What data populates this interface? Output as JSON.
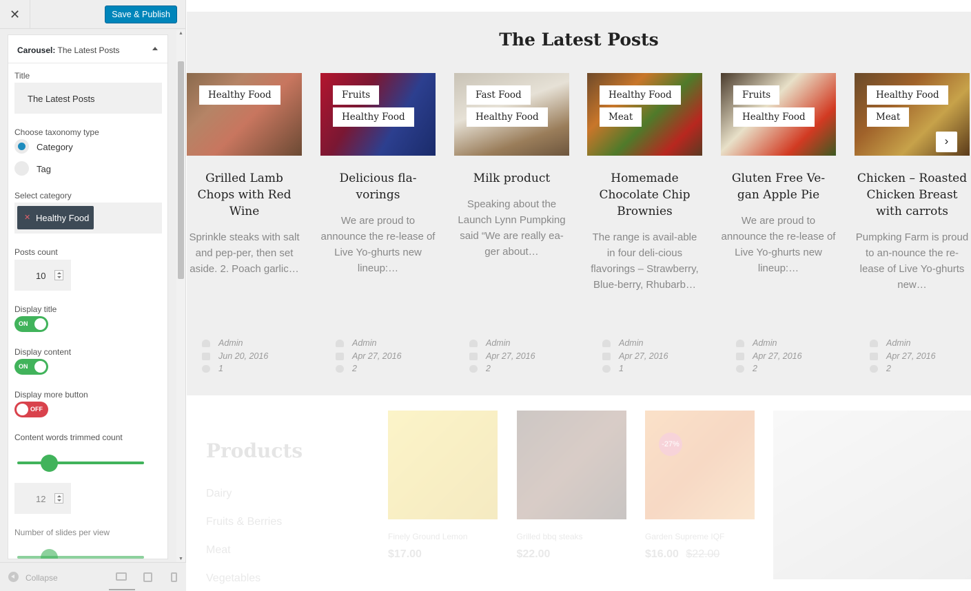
{
  "sidebar": {
    "close_label": "✕",
    "save_label": "Save & Publish",
    "section": {
      "prefix": "Carousel:",
      "name": "The Latest Posts"
    },
    "fields": {
      "title_label": "Title",
      "title_value": "The Latest Posts",
      "taxonomy_label": "Choose taxonomy type",
      "taxonomy_options": [
        "Category",
        "Tag"
      ],
      "taxonomy_selected": "Category",
      "category_label": "Select category",
      "category_chip": "Healthy Food",
      "posts_count_label": "Posts count",
      "posts_count_value": "10",
      "display_title_label": "Display title",
      "display_title_state": "ON",
      "display_content_label": "Display content",
      "display_content_state": "ON",
      "display_more_label": "Display more button",
      "display_more_state": "OFF",
      "trim_label": "Content words trimmed count",
      "trim_slider_fraction": 0.25,
      "trim_value": "12",
      "slides_label": "Number of slides per view",
      "slides_slider_fraction": 0.25
    },
    "footer": {
      "collapse_label": "Collapse",
      "devices": [
        "desktop-icon",
        "tablet-icon",
        "mobile-icon"
      ]
    }
  },
  "preview": {
    "heading": "The Latest Posts",
    "cards": [
      {
        "tags": [
          "Healthy Food"
        ],
        "title": "Grilled Lamb Chops with Red Wine",
        "excerpt": "Sprinkle steaks with salt and pep-per, then set aside. 2. Poach garlic…",
        "author": "Admin",
        "date": "Jun 20, 2016",
        "comments": "1",
        "img": "linear-gradient(135deg,#8a6a4d 0%,#b58466 30%,#c8765f 55%,#6b4a34 100%)"
      },
      {
        "tags": [
          "Fruits",
          "Healthy Food"
        ],
        "title": "Delicious fla-vorings",
        "excerpt": "We are proud to announce the re-lease of Live Yo-ghurts new lineup:…",
        "author": "Admin",
        "date": "Apr 27, 2016",
        "comments": "2",
        "img": "linear-gradient(120deg,#b3162e 0%,#7a1733 35%,#2c3f8f 65%,#1a2b6a 100%)"
      },
      {
        "tags": [
          "Fast Food",
          "Healthy Food"
        ],
        "title": "Milk product",
        "excerpt": "Speaking about the Launch Lynn Pumpking said “We are really ea-ger about…",
        "author": "Admin",
        "date": "Apr 27, 2016",
        "comments": "2",
        "img": "linear-gradient(160deg,#c9c3b6 0%,#e6e1d6 40%,#9a7d5a 75%,#6d563e 100%)"
      },
      {
        "tags": [
          "Healthy Food",
          "Meat"
        ],
        "title": "Homemade Chocolate Chip Brownies",
        "excerpt": "The range is avail-able in four deli-cious flavorings – Strawberry, Blue-berry, Rhubarb…",
        "author": "Admin",
        "date": "Apr 27, 2016",
        "comments": "1",
        "img": "linear-gradient(135deg,#6e4a2a 0%,#c8762a 30%,#4f7a2a 55%,#b8271f 80%,#5a3a22 100%)"
      },
      {
        "tags": [
          "Fruits",
          "Healthy Food"
        ],
        "title": "Gluten Free Ve-gan Apple Pie",
        "excerpt": "We are proud to announce the re-lease of Live Yo-ghurts new lineup:…",
        "author": "Admin",
        "date": "Apr 27, 2016",
        "comments": "2",
        "img": "linear-gradient(135deg,#4a3b2c 0%,#e8e0c8 40%,#d23a22 75%,#3b5a22 100%)"
      },
      {
        "tags": [
          "Healthy Food",
          "Meat"
        ],
        "title": "Chicken – Roasted Chicken Breast with carrots",
        "excerpt": "Pumpking Farm is proud to an-nounce the re-lease of Live Yo-ghurts new…",
        "author": "Admin",
        "date": "Apr 27, 2016",
        "comments": "2",
        "img": "linear-gradient(135deg,#6a4a2a 0%,#a0622a 35%,#c7a24a 65%,#5a3a1a 100%)"
      }
    ],
    "products": {
      "title": "Products",
      "categories": [
        "Dairy",
        "Fruits & Berries",
        "Meat",
        "Vegetables"
      ],
      "items": [
        {
          "name": "Finely Ground Lemon",
          "price": "$17.00",
          "old_price": "",
          "badge": "",
          "img": "linear-gradient(135deg,#f3d52a,#e8c21a 50%,#d9b010)"
        },
        {
          "name": "Grilled bbq steaks",
          "price": "$22.00",
          "old_price": "",
          "badge": "",
          "img": "linear-gradient(135deg,#3a2418,#6a3a24 50%,#2a1a12)"
        },
        {
          "name": "Garden Supreme IQF",
          "price": "$16.00",
          "old_price": "$22.00",
          "badge": "-27%",
          "img": "linear-gradient(135deg,#f08a2a,#e06a1a 50%,#f0a04a)"
        }
      ]
    }
  }
}
